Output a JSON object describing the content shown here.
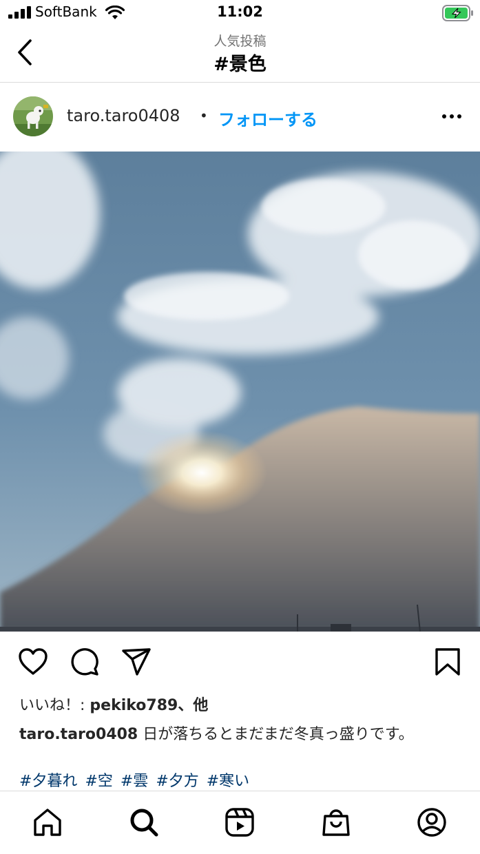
{
  "status_bar": {
    "carrier": "SoftBank",
    "time": "11:02",
    "icons": [
      "signal-icon",
      "wifi-icon",
      "battery-charging-icon"
    ]
  },
  "header": {
    "subtitle": "人気投稿",
    "title": "#景色",
    "back_icon": "chevron-left-icon"
  },
  "post": {
    "username": "taro.taro0408",
    "separator": "•",
    "follow_label": "フォローする",
    "more_icon": "more-horizontal-icon",
    "image": "sky-clouds-photo",
    "actions": [
      "heart-icon",
      "comment-icon",
      "share-icon",
      "bookmark-icon"
    ],
    "likes": {
      "prefix": "いいね！: ",
      "user": "pekiko789",
      "suffix": "、他"
    },
    "caption": {
      "user": "taro.taro0408",
      "text": " 日が落ちるとまだまだ冬真っ盛りです。"
    },
    "hashtags": [
      "#夕暮れ",
      "#空",
      "#雲",
      "#夕方",
      "#寒い"
    ]
  },
  "tabbar": {
    "items": [
      "home-icon",
      "search-icon",
      "reels-icon",
      "shop-icon",
      "profile-icon"
    ]
  },
  "colors": {
    "link_blue": "#0095f6",
    "hashtag": "#00376b",
    "battery_green": "#34c759"
  }
}
